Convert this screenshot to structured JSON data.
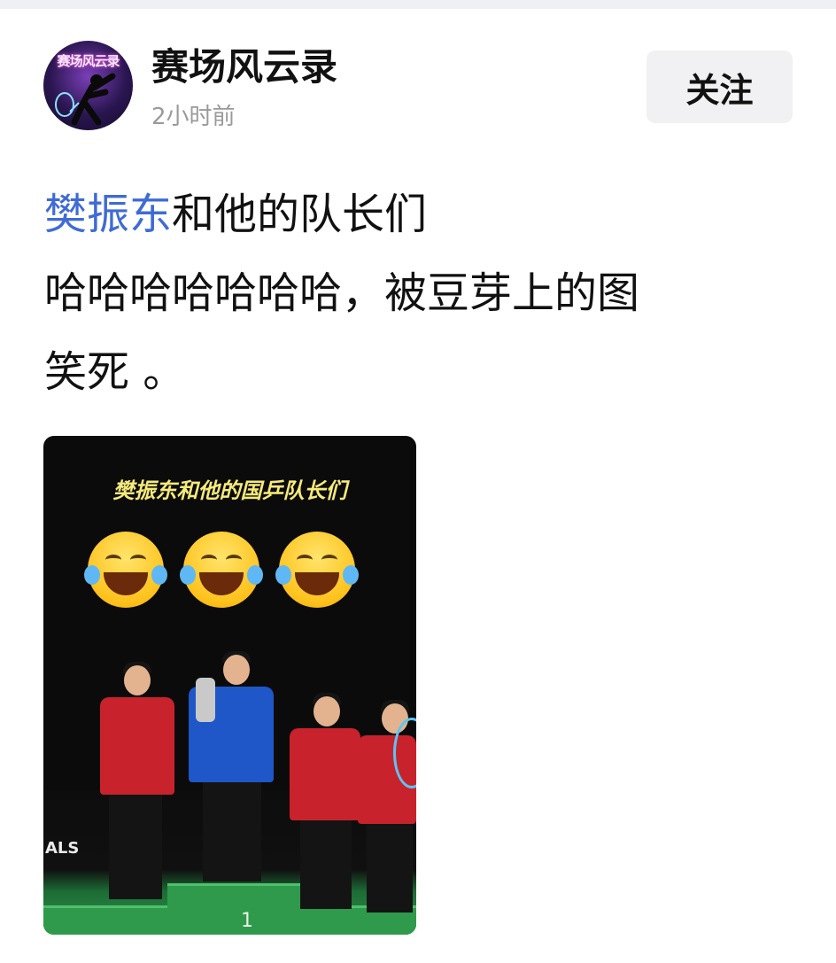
{
  "post": {
    "author_name": "赛场风云录",
    "avatar_text": "赛场风云录",
    "time": "2小时前",
    "follow_label": "关注",
    "mention": "樊振东",
    "text_after_mention": "和他的队长们",
    "text_line2": "哈哈哈哈哈哈哈，被豆芽上的图",
    "text_line3": "笑死 。"
  },
  "image": {
    "caption": "樊振东和他的国乒队长们",
    "sign_text": "ALS",
    "podium_number": "1",
    "emoji_icon": "face-with-tears-of-joy-icon"
  },
  "colors": {
    "mention": "#3f6bd6",
    "follow_bg": "#f1f1f3",
    "caption": "#f6ea7a"
  }
}
